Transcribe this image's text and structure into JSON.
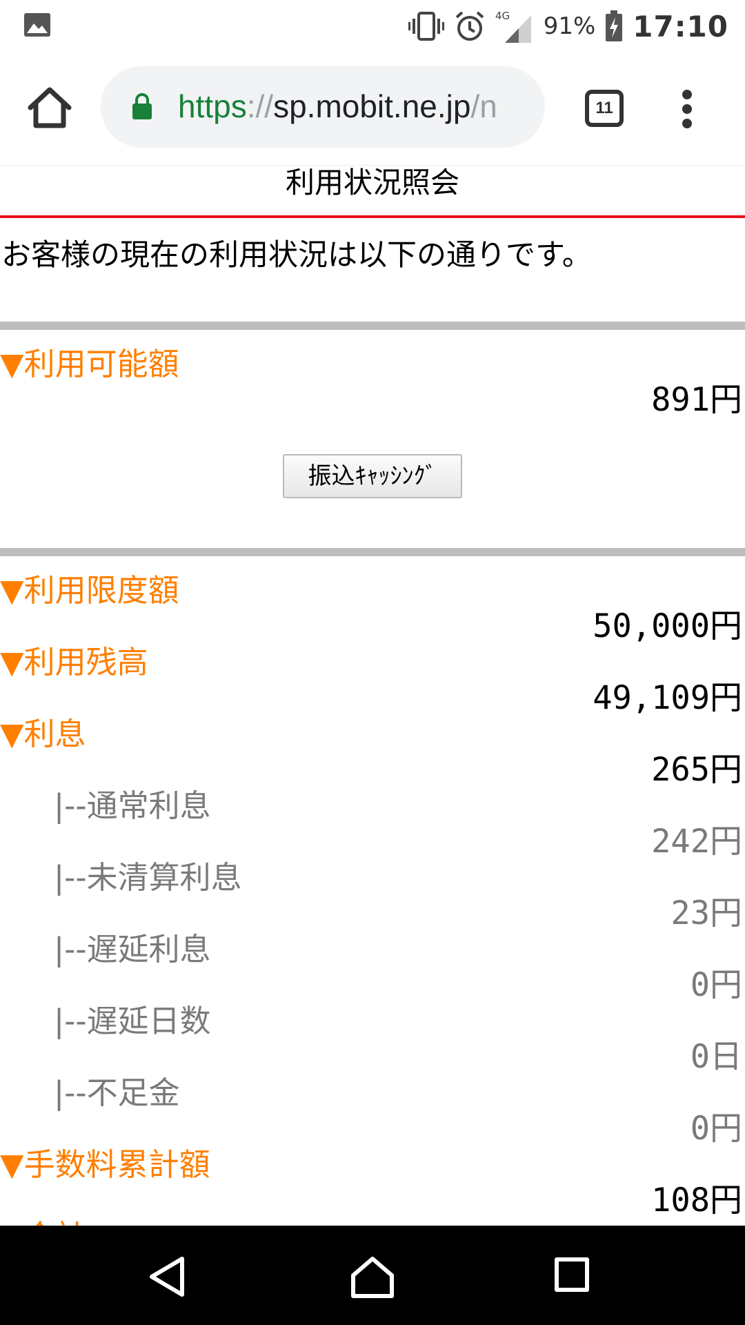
{
  "status_bar": {
    "battery_percent": "91%",
    "time": "17:10",
    "network": "4G",
    "icons": [
      "image-icon",
      "vibrate-icon",
      "alarm-icon",
      "signal-icon",
      "battery-charging-icon"
    ]
  },
  "browser": {
    "url_scheme": "https",
    "url_sep": "://",
    "url_host": "sp.mobit.ne.jp",
    "url_path": "/n",
    "tab_count": "11",
    "colors": {
      "lock": "#188038",
      "scheme": "#188038"
    }
  },
  "page": {
    "title": "利用状況照会",
    "intro": "お客様の現在の利用状況は以下の通りです。",
    "available": {
      "label": "▼利用可能額",
      "amount": "891円"
    },
    "cash_button": "振込ｷｬｯｼﾝｸﾞ",
    "limit": {
      "label": "▼利用限度額",
      "amount": "50,000円"
    },
    "balance": {
      "label": "▼利用残高",
      "amount": "49,109円"
    },
    "interest": {
      "label": "▼利息",
      "amount": "265円"
    },
    "interest_details": [
      {
        "label": "|--通常利息",
        "amount": "242円"
      },
      {
        "label": "|--未清算利息",
        "amount": "23円"
      },
      {
        "label": "|--遅延利息",
        "amount": "0円"
      },
      {
        "label": "|--遅延日数",
        "amount": "0日"
      },
      {
        "label": "|--不足金",
        "amount": "0円"
      }
    ],
    "fees": {
      "label": "▼手数料累計額",
      "amount": "108円"
    },
    "next_partial_label": "▼合計",
    "colors": {
      "heading": "#ff7f00",
      "rule": "#e8101c",
      "divider": "#bdbdbd"
    }
  }
}
